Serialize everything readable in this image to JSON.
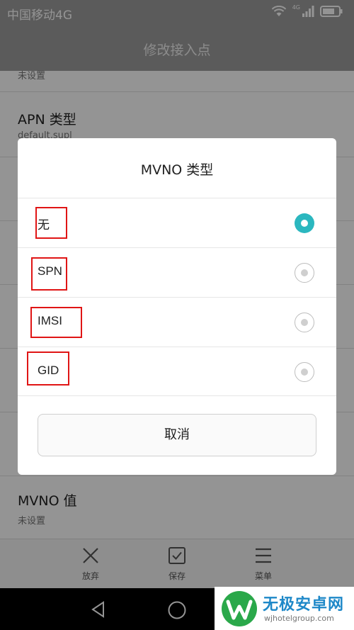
{
  "status_bar": {
    "carrier": "中国移动4G",
    "network": "4G"
  },
  "app_bar": {
    "title": "修改接入点"
  },
  "settings_rows": {
    "top_partial_value": "未设置",
    "apn_type": {
      "title": "APN 类型",
      "value": "default,supl"
    },
    "mvno_value": {
      "title": "MVNO 值",
      "value": "未设置"
    }
  },
  "dialog": {
    "title": "MVNO 类型",
    "options": [
      {
        "label": "无",
        "selected": true
      },
      {
        "label": "SPN",
        "selected": false
      },
      {
        "label": "IMSI",
        "selected": false
      },
      {
        "label": "GID",
        "selected": false
      }
    ],
    "cancel_label": "取消"
  },
  "bottom_bar": {
    "discard_label": "放弃",
    "save_label": "保存",
    "menu_label": "菜单"
  },
  "watermark": {
    "name": "无极安卓网",
    "url": "wjhotelgroup.com"
  },
  "colors": {
    "accent": "#2bb7bf",
    "highlight_box": "#e01515"
  }
}
